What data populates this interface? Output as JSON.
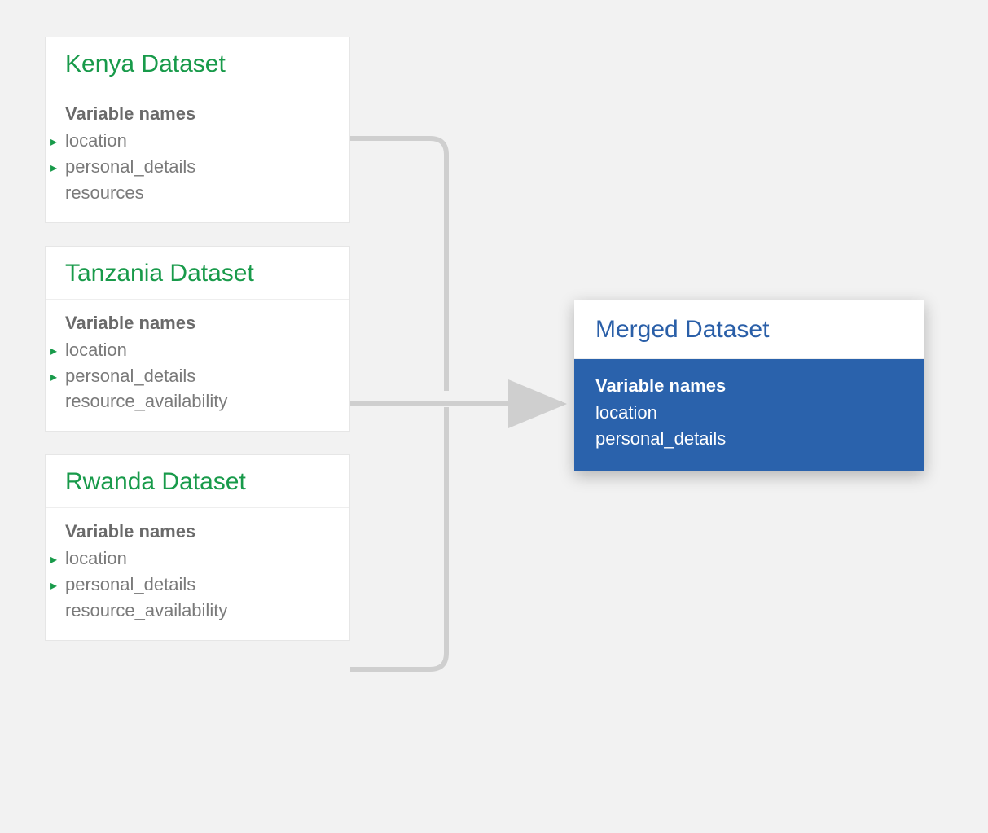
{
  "section_label": "Variable names",
  "sources": [
    {
      "title": "Kenya Dataset",
      "vars": [
        {
          "name": "location",
          "marked": true
        },
        {
          "name": "personal_details",
          "marked": true
        },
        {
          "name": "resources",
          "marked": false
        }
      ]
    },
    {
      "title": "Tanzania Dataset",
      "vars": [
        {
          "name": "location",
          "marked": true
        },
        {
          "name": "personal_details",
          "marked": true
        },
        {
          "name": "resource_availability",
          "marked": false
        }
      ]
    },
    {
      "title": "Rwanda Dataset",
      "vars": [
        {
          "name": "location",
          "marked": true
        },
        {
          "name": "personal_details",
          "marked": true
        },
        {
          "name": "resource_availability",
          "marked": false
        }
      ]
    }
  ],
  "merged": {
    "title": "Merged Dataset",
    "vars": [
      {
        "name": "location"
      },
      {
        "name": "personal_details"
      }
    ]
  },
  "colors": {
    "source_title": "#189a4a",
    "merged_title": "#2a5fa8",
    "merged_body_bg": "#2a62ac",
    "connector": "#cfcfcf"
  }
}
